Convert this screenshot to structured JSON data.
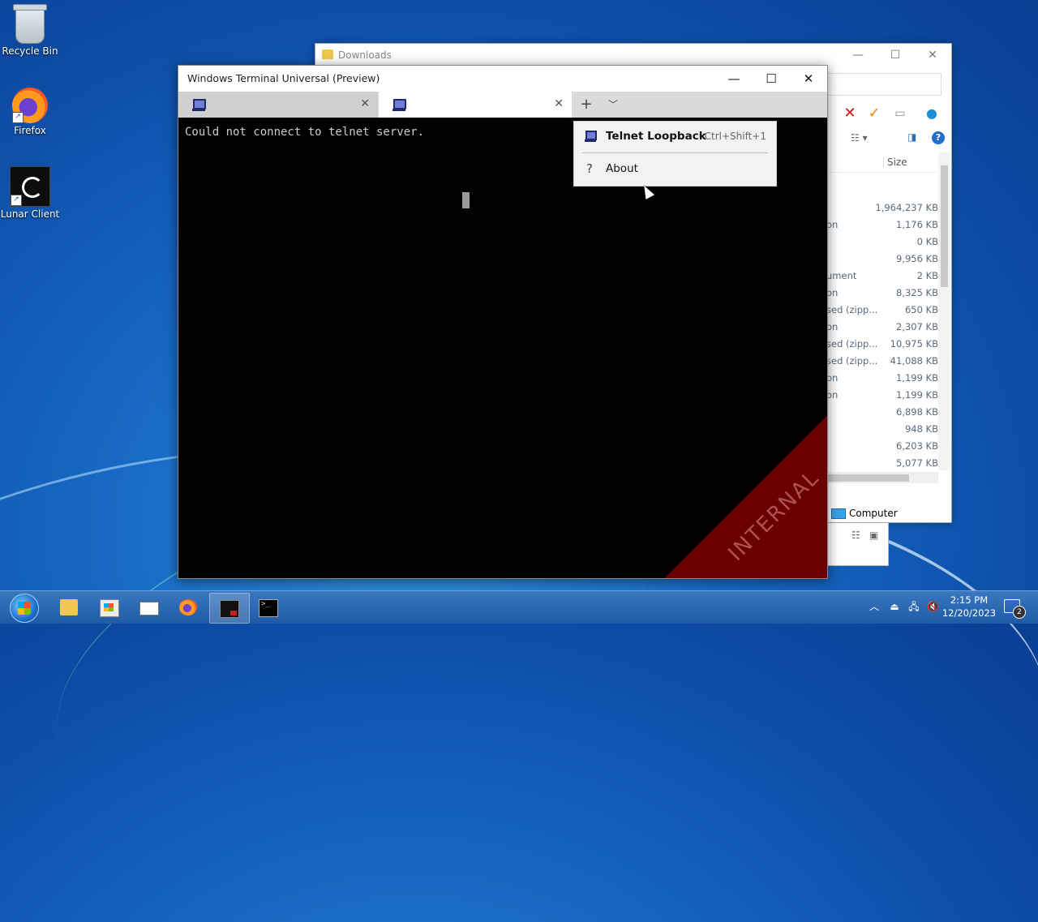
{
  "desktop": {
    "icons": [
      {
        "label": "Recycle Bin",
        "icon": "recycle-bin-icon"
      },
      {
        "label": "Firefox",
        "icon": "firefox-icon"
      },
      {
        "label": "Lunar Client",
        "icon": "lunar-client-icon"
      }
    ]
  },
  "explorer": {
    "title": "Downloads",
    "column_size": "Size",
    "rows": [
      {
        "type": "",
        "size": "1,964,237 KB"
      },
      {
        "type": "on",
        "size": "1,176 KB"
      },
      {
        "type": "",
        "size": "0 KB"
      },
      {
        "type": "",
        "size": "9,956 KB"
      },
      {
        "type": "ument",
        "size": "2 KB"
      },
      {
        "type": "on",
        "size": "8,325 KB"
      },
      {
        "type": "sed (zipp...",
        "size": "650 KB"
      },
      {
        "type": "on",
        "size": "2,307 KB"
      },
      {
        "type": "sed (zipp...",
        "size": "10,975 KB"
      },
      {
        "type": "sed (zipp...",
        "size": "41,088 KB"
      },
      {
        "type": "on",
        "size": "1,199 KB"
      },
      {
        "type": "on",
        "size": "1,199 KB"
      },
      {
        "type": "",
        "size": "6,898 KB"
      },
      {
        "type": "",
        "size": "948 KB"
      },
      {
        "type": "",
        "size": "6,203 KB"
      },
      {
        "type": "",
        "size": "5,077 KB"
      }
    ],
    "status_location": "Computer"
  },
  "terminal": {
    "title": "Windows Terminal Universal (Preview)",
    "output_line": "Could not connect to telnet server.",
    "watermark": "INTERNAL",
    "menu": {
      "profile_label": "Telnet Loopback",
      "profile_shortcut": "Ctrl+Shift+1",
      "about_label": "About"
    }
  },
  "taskbar": {
    "time": "2:15 PM",
    "date": "12/20/2023",
    "notification_count": "2"
  }
}
